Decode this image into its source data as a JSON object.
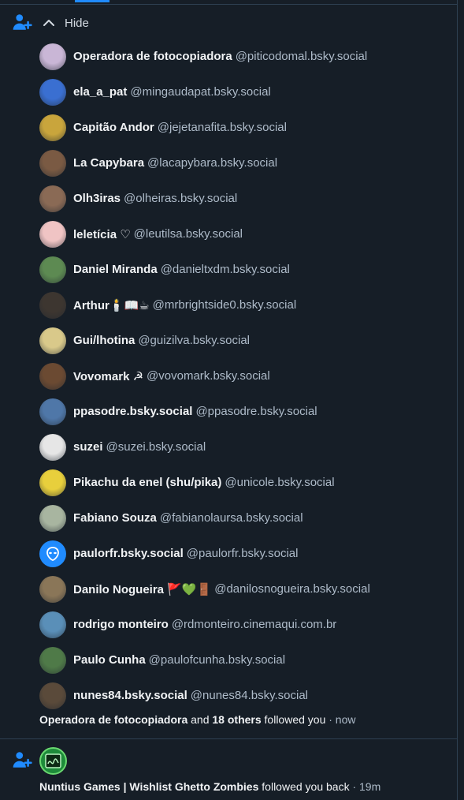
{
  "notification1": {
    "toggle_label": "Hide",
    "followers": [
      {
        "name": "Operadora de fotocopiadora",
        "handle": "@piticodomal.bsky.social",
        "avatar_color": "#c9b6d6"
      },
      {
        "name": "ela_a_pat",
        "handle": "@mingaudapat.bsky.social",
        "avatar_color": "#3a6fd1"
      },
      {
        "name": "Capitão Andor",
        "handle": "@jejetanafita.bsky.social",
        "avatar_color": "#c9a53c"
      },
      {
        "name": "La Capybara",
        "handle": "@lacapybara.bsky.social",
        "avatar_color": "#7a5a43"
      },
      {
        "name": "Olh3iras",
        "handle": "@olheiras.bsky.social",
        "avatar_color": "#8a6a55"
      },
      {
        "name": "leletícia ♡",
        "handle": "@leutilsa.bsky.social",
        "avatar_color": "#f0c4c4"
      },
      {
        "name": "Daniel Miranda",
        "handle": "@danieltxdm.bsky.social",
        "avatar_color": "#5d8a52"
      },
      {
        "name": "Arthur🕯️📖☕",
        "handle": "@mrbrightside0.bsky.social",
        "avatar_color": "#3d3630"
      },
      {
        "name": "Gui/lhotina",
        "handle": "@guizilva.bsky.social",
        "avatar_color": "#d9c98a"
      },
      {
        "name": "Vovomark ☭",
        "handle": "@vovomark.bsky.social",
        "avatar_color": "#6b4a32"
      },
      {
        "name": "ppasodre.bsky.social",
        "handle": "@ppasodre.bsky.social",
        "avatar_color": "#4f77a8"
      },
      {
        "name": "suzei",
        "handle": "@suzei.bsky.social",
        "avatar_color": "#e6e6e6"
      },
      {
        "name": "Pikachu da enel (shu/pika)",
        "handle": "@unicole.bsky.social",
        "avatar_color": "#e8cf3c"
      },
      {
        "name": "Fabiano Souza",
        "handle": "@fabianolaursa.bsky.social",
        "avatar_color": "#a8b5a0"
      },
      {
        "name": "paulorfr.bsky.social",
        "handle": "@paulorfr.bsky.social",
        "avatar_color": "#208bfe"
      },
      {
        "name": "Danilo Nogueira 🚩💚🚪",
        "handle": "@danilosnogueira.bsky.social",
        "avatar_color": "#8a7658"
      },
      {
        "name": "rodrigo monteiro",
        "handle": "@rdmonteiro.cinemaqui.com.br",
        "avatar_color": "#5a8fb8"
      },
      {
        "name": "Paulo Cunha",
        "handle": "@paulofcunha.bsky.social",
        "avatar_color": "#4f7a48"
      },
      {
        "name": "nunes84.bsky.social",
        "handle": "@nunes84.bsky.social",
        "avatar_color": "#5a4a3a"
      }
    ],
    "summary": {
      "first_name": "Operadora de fotocopiadora",
      "and": "and",
      "others": "18 others",
      "action": "followed you",
      "time": "· now"
    }
  },
  "notification2": {
    "name": "Nuntius Games | Wishlist Ghetto Zombies",
    "action": "followed you back",
    "time": "· 19m"
  },
  "colors": {
    "background": "#161e27",
    "accent": "#208bfe",
    "muted_text": "#aebbc9",
    "divider": "#2e4052"
  }
}
